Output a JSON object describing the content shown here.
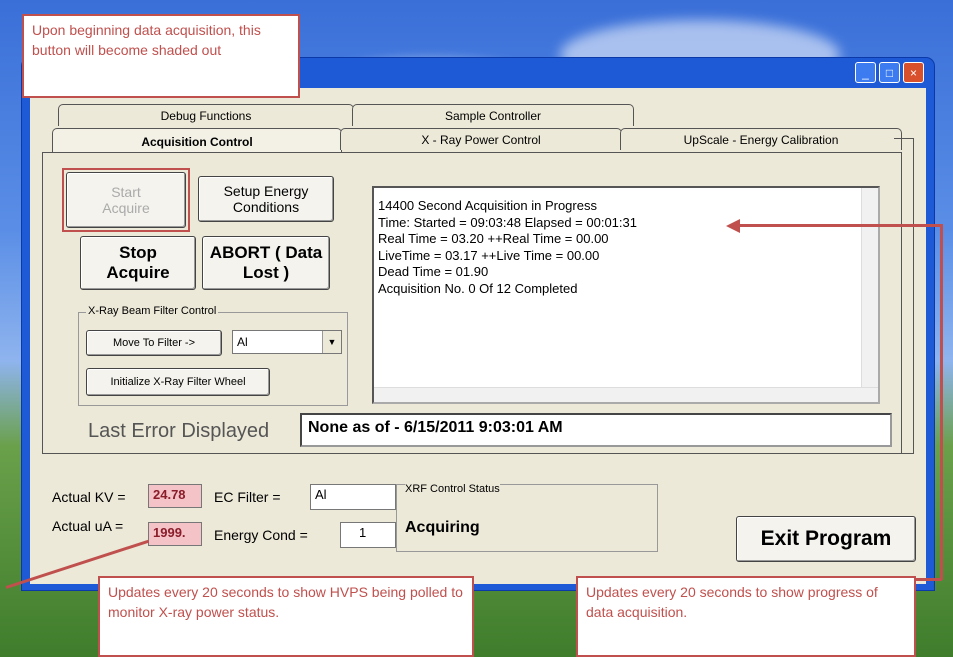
{
  "colors": {
    "accent": "#c0504d",
    "title_bar": "#1f5ad6",
    "pink_value": "#f3c3c8"
  },
  "notes": {
    "top": "Upon beginning data acquisition, this button will become shaded out",
    "bottom_left": "Updates every 20 seconds to show HVPS being polled to monitor X-ray power status.",
    "bottom_right": "Updates every 20 seconds to show progress of data acquisition."
  },
  "tabs": {
    "back_row": [
      "Debug Functions",
      "Sample Controller"
    ],
    "front_row": [
      "Acquisition Control",
      "X - Ray Power Control",
      "UpScale - Energy Calibration"
    ]
  },
  "buttons": {
    "start": "Start Acquire",
    "setup": "Setup Energy Conditions",
    "stop": "Stop Acquire",
    "abort": "ABORT ( Data Lost )",
    "move_filter": "Move To Filter ->",
    "init_filter": "Initialize X-Ray Filter Wheel",
    "exit": "Exit Program"
  },
  "filter_group": {
    "label": "X-Ray Beam Filter Control",
    "selected": "Al"
  },
  "log": {
    "lines": [
      "14400 Second Acquisition in Progress",
      "Time: Started = 09:03:48  Elapsed = 00:01:31",
      "Real Time = 03.20  ++Real Time = 00.00",
      "LiveTime = 03.17  ++Live Time = 00.00",
      "Dead Time = 01.90",
      "Acquisition No. 0  Of 12 Completed"
    ]
  },
  "error": {
    "label": "Last Error Displayed",
    "value": "None as of - 6/15/2011 9:03:01 AM"
  },
  "status": {
    "kv_label": "Actual KV =",
    "kv_value": "24.78",
    "ua_label": "Actual uA =",
    "ua_value": "1999.",
    "ec_filter_label": "EC Filter =",
    "ec_filter_value": "Al",
    "energy_cond_label": "Energy Cond =",
    "energy_cond_value": "1",
    "xrf_title": "XRF Control Status",
    "xrf_value": "Acquiring"
  }
}
